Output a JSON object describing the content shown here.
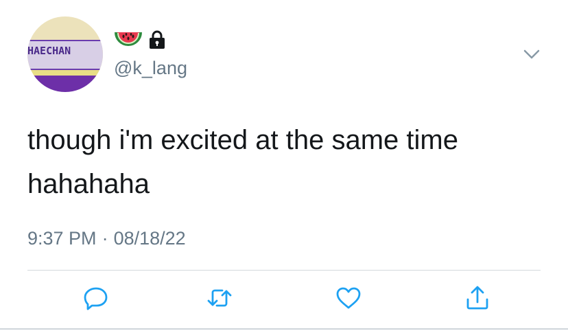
{
  "profile": {
    "avatar_text": "HAECHAN",
    "emoji_icon": "watermelon-icon",
    "lock_icon": "lock-icon",
    "handle": "@k_lang"
  },
  "tweet": {
    "text_line1": "though i'm excited at the same time",
    "text_line2": "hahahaha",
    "time": "9:37 PM",
    "separator": "·",
    "date": "08/18/22"
  },
  "actions": [
    {
      "name": "reply-icon"
    },
    {
      "name": "retweet-icon"
    },
    {
      "name": "like-icon"
    },
    {
      "name": "share-icon"
    }
  ],
  "colors": {
    "text": "#14171a",
    "secondary": "#657786",
    "icon": "#1da1f2",
    "divider": "#d4d9dd"
  }
}
